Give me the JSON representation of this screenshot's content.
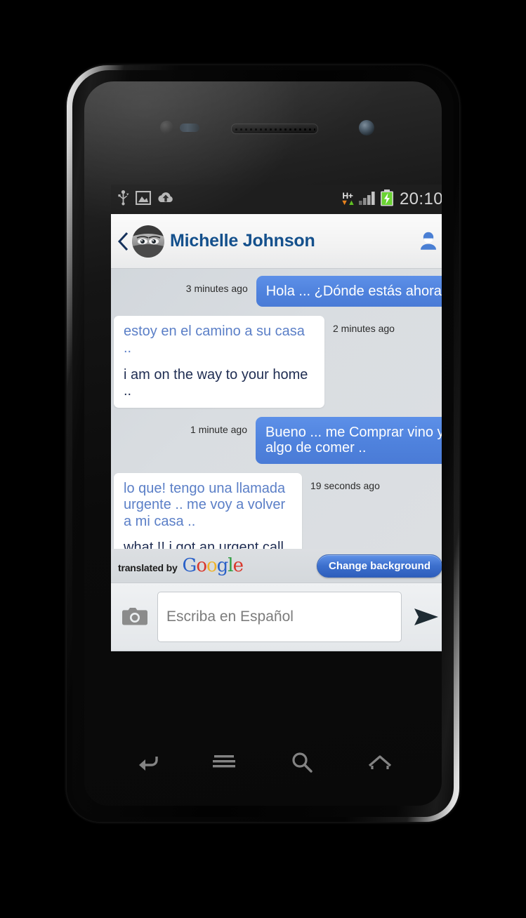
{
  "status_bar": {
    "left_icons": [
      "usb-icon",
      "screenshot-image-icon",
      "cloud-upload-icon"
    ],
    "network_type": "H+",
    "data_arrows": "↓↑",
    "signal_icon": "signal-bars-icon",
    "battery_icon": "battery-charging-icon",
    "clock": "20:10"
  },
  "chat_header": {
    "back_icon": "back-chevron-icon",
    "avatar": "contact-avatar",
    "contact_name": "Michelle Johnson",
    "contact_icon": "person-icon"
  },
  "messages": [
    {
      "direction": "out",
      "timestamp": "3 minutes ago",
      "text": "Hola ... ¿Dónde estás ahora?",
      "original": null,
      "translation": null
    },
    {
      "direction": "in",
      "timestamp": "2 minutes ago",
      "text": null,
      "original": "estoy en el camino a su casa ..",
      "translation": "i am on the way to your home .."
    },
    {
      "direction": "out",
      "timestamp": "1 minute ago",
      "text": "Bueno ... me Comprar vino y algo de comer ..",
      "original": null,
      "translation": null
    },
    {
      "direction": "in",
      "timestamp": "19 seconds ago",
      "text": null,
      "original": "lo que! tengo una llamada urgente .. me voy a volver a mi casa ..",
      "translation": "what !! i got an urgent call .. i am going back to my home .."
    }
  ],
  "translate_bar": {
    "by_label": "translated by",
    "google_logo": "Google",
    "change_background_label": "Change background"
  },
  "composer": {
    "camera_icon": "camera-icon",
    "input_placeholder": "Escriba en Español",
    "input_value": "",
    "send_icon": "send-icon"
  },
  "nav_bar": {
    "buttons": [
      "back-icon",
      "menu-icon",
      "search-icon",
      "home-icon"
    ]
  },
  "colors": {
    "outgoing_bubble": "#4f82dd",
    "incoming_bubble": "#ffffff",
    "original_text": "#5b7fc7",
    "translated_text": "#1f2d52",
    "contact_name": "#14508c",
    "chat_background": "#d9dde1",
    "accent_button": "#3c6fcd"
  }
}
